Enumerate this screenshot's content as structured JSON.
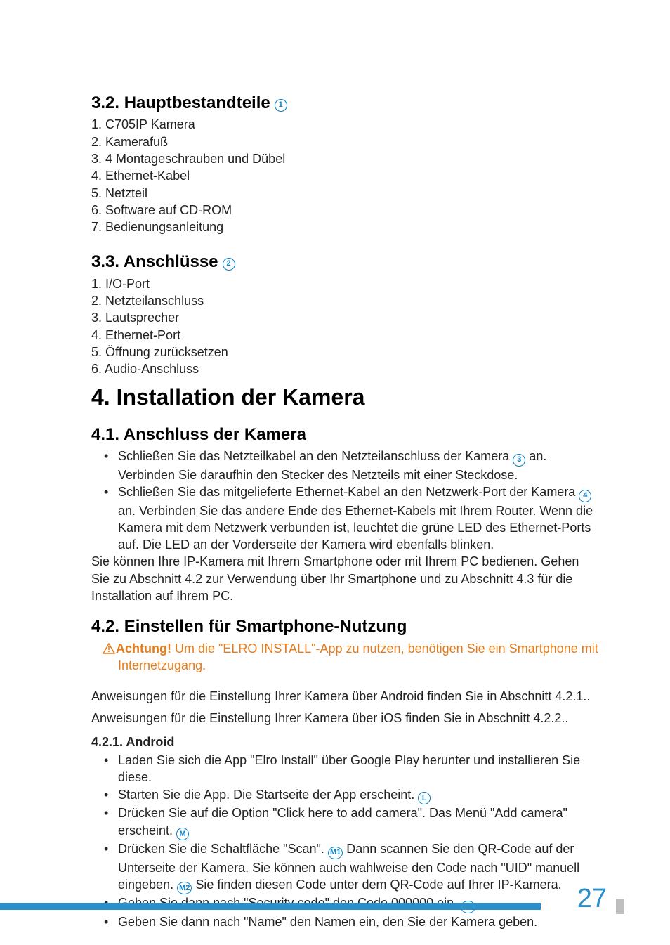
{
  "sec32": {
    "title": "3.2.  Hauptbestandteile",
    "ref": "1",
    "items": [
      "C705IP Kamera",
      "Kamerafuß",
      "4 Montageschrauben und Dübel",
      "Ethernet-Kabel",
      "Netzteil",
      "Software auf CD-ROM",
      "Bedienungsanleitung"
    ]
  },
  "sec33": {
    "title": "3.3.  Anschlüsse",
    "ref": "2",
    "items": [
      "I/O-Port",
      "Netzteilanschluss",
      "Lautsprecher",
      "Ethernet-Port",
      "Öffnung zurücksetzen",
      "Audio-Anschluss"
    ]
  },
  "sec4": {
    "title": "4.   Installation der Kamera"
  },
  "sec41": {
    "title": "4.1.  Anschluss der Kamera",
    "bullets": [
      {
        "pre": "Schließen Sie das Netzteilkabel an den Netzteilanschluss der Kamera ",
        "ref": "3",
        "post": " an. Verbinden Sie daraufhin den Stecker des Netzteils mit einer Steckdose."
      },
      {
        "pre": "Schließen Sie das mitgelieferte Ethernet-Kabel an den Netzwerk-Port der Kamera ",
        "ref": "4",
        "post": " an. Verbinden Sie das andere Ende des Ethernet-Kabels mit Ihrem Router. Wenn die Kamera mit dem Netzwerk verbunden ist, leuchtet die grüne LED des Ethernet-Ports auf. Die LED an der Vorderseite der Kamera wird ebenfalls blinken."
      }
    ],
    "trailer": "Sie können Ihre IP-Kamera mit Ihrem Smartphone oder mit Ihrem PC bedienen. Gehen Sie zu Abschnitt 4.2 zur Verwendung über Ihr Smartphone und zu Abschnitt 4.3 für die Installation auf Ihrem PC."
  },
  "sec42": {
    "title": "4.2.  Einstellen für Smartphone-Nutzung",
    "warn_label": "Achtung!",
    "warn_text": " Um die \"ELRO INSTALL\"-App zu nutzen, benötigen Sie ein Smartphone mit Internetzugang.",
    "line1": "Anweisungen für die Einstellung Ihrer Kamera über Android finden Sie in Abschnitt 4.2.1..",
    "line2": "Anweisungen für die Einstellung Ihrer Kamera über iOS finden Sie in Abschnitt 4.2.2.."
  },
  "sec421": {
    "title": "4.2.1.  Android",
    "b1": "Laden Sie sich die App \"Elro Install\" über Google Play herunter und installieren Sie diese.",
    "b2_pre": "Starten Sie die App. Die Startseite der App erscheint. ",
    "b2_ref": "L",
    "b3_pre": "Drücken Sie auf die Option \"Click here to add camera\". Das Menü \"Add camera\" erscheint. ",
    "b3_ref": "M",
    "b4_pre": "Drücken Sie die Schaltfläche \"Scan\". ",
    "b4_ref1": "M1",
    "b4_mid": " Dann scannen Sie den QR-Code auf der Unterseite der Kamera. Sie können auch wahlweise den Code nach \"UID\" manuell eingeben. ",
    "b4_ref2": "M2",
    "b4_post": " Sie finden diesen Code unter dem QR-Code auf Ihrer IP-Kamera.",
    "b5_pre": "Geben Sie dann nach \"Security code\" den Code 000000 ein. ",
    "b5_ref": "M3",
    "b6": "Geben Sie dann nach \"Name\" den Namen ein, den Sie der Kamera geben."
  },
  "page_number": "27"
}
